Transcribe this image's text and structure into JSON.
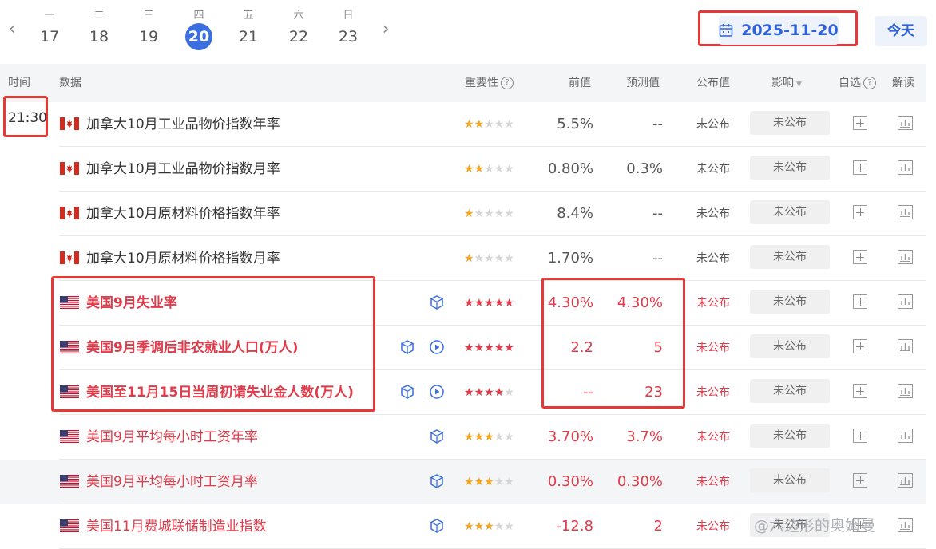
{
  "calendar": {
    "days": [
      {
        "weekday": "一",
        "date": "17",
        "active": false
      },
      {
        "weekday": "二",
        "date": "18",
        "active": false
      },
      {
        "weekday": "三",
        "date": "19",
        "active": false
      },
      {
        "weekday": "四",
        "date": "20",
        "active": true
      },
      {
        "weekday": "五",
        "date": "21",
        "active": false
      },
      {
        "weekday": "六",
        "date": "22",
        "active": false
      },
      {
        "weekday": "日",
        "date": "23",
        "active": false
      }
    ],
    "selected_date": "2025-11-20",
    "today_label": "今天"
  },
  "table": {
    "headers": {
      "time": "时间",
      "data": "数据",
      "importance": "重要性",
      "previous": "前值",
      "forecast": "预测值",
      "published": "公布值",
      "impact": "影响",
      "watchlist": "自选",
      "interpret": "解读"
    },
    "time_slot": "21:30",
    "rows": [
      {
        "country": "CA",
        "name": "加拿大10月工业品物价指数年率",
        "stars": 2,
        "previous": "5.5%",
        "forecast": "--",
        "published": "未公布",
        "impact": "未公布",
        "red": false,
        "bold": false,
        "icons": []
      },
      {
        "country": "CA",
        "name": "加拿大10月工业品物价指数月率",
        "stars": 2,
        "previous": "0.80%",
        "forecast": "0.3%",
        "published": "未公布",
        "impact": "未公布",
        "red": false,
        "bold": false,
        "icons": []
      },
      {
        "country": "CA",
        "name": "加拿大10月原材料价格指数年率",
        "stars": 1,
        "previous": "8.4%",
        "forecast": "--",
        "published": "未公布",
        "impact": "未公布",
        "red": false,
        "bold": false,
        "icons": []
      },
      {
        "country": "CA",
        "name": "加拿大10月原材料价格指数月率",
        "stars": 1,
        "previous": "1.70%",
        "forecast": "--",
        "published": "未公布",
        "impact": "未公布",
        "red": false,
        "bold": false,
        "icons": []
      },
      {
        "country": "US",
        "name": "美国9月失业率",
        "stars": 5,
        "previous": "4.30%",
        "forecast": "4.30%",
        "published": "未公布",
        "impact": "未公布",
        "red": true,
        "bold": true,
        "icons": [
          "cube"
        ]
      },
      {
        "country": "US",
        "name": "美国9月季调后非农就业人口(万人)",
        "stars": 5,
        "previous": "2.2",
        "forecast": "5",
        "published": "未公布",
        "impact": "未公布",
        "red": true,
        "bold": true,
        "icons": [
          "cube",
          "play"
        ]
      },
      {
        "country": "US",
        "name": "美国至11月15日当周初请失业金人数(万人)",
        "stars": 4,
        "previous": "--",
        "forecast": "23",
        "published": "未公布",
        "impact": "未公布",
        "red": true,
        "bold": true,
        "icons": [
          "cube",
          "play"
        ]
      },
      {
        "country": "US",
        "name": "美国9月平均每小时工资年率",
        "stars": 3,
        "previous": "3.70%",
        "forecast": "3.7%",
        "published": "未公布",
        "impact": "未公布",
        "red": true,
        "bold": false,
        "icons": [
          "cube"
        ]
      },
      {
        "country": "US",
        "name": "美国9月平均每小时工资月率",
        "stars": 3,
        "previous": "0.30%",
        "forecast": "0.30%",
        "published": "未公布",
        "impact": "未公布",
        "red": true,
        "bold": false,
        "icons": [
          "cube"
        ],
        "highlight": true
      },
      {
        "country": "US",
        "name": "美国11月费城联储制造业指数",
        "stars": 3,
        "previous": "-12.8",
        "forecast": "2",
        "published": "未公布",
        "impact": "未公布",
        "red": true,
        "bold": false,
        "icons": [
          "cube"
        ]
      }
    ]
  },
  "watermark": "@六边形的奥姆曼",
  "colors": {
    "accent": "#3b6fe0",
    "red": "#e03b4a",
    "star": "#f5a623",
    "annotation": "#e53935"
  }
}
